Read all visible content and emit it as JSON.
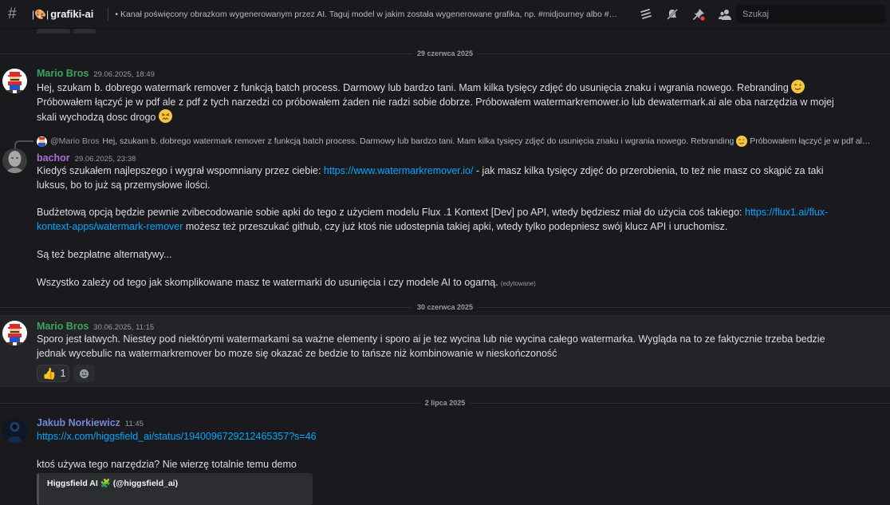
{
  "topbar": {
    "channel_prefix": "|🎨|",
    "channel_name": "grafiki-ai",
    "topic": "• Kanał poświęcony obrazkom wygenerowanym przez AI. Taguj model w jakim została wygenerowane grafika, np. #midjourney albo #…",
    "search_placeholder": "Szukaj"
  },
  "dividers": [
    "29 czerwca 2025",
    "30 czerwca 2025",
    "2 lipca 2025"
  ],
  "messages": {
    "m1": {
      "author": "Mario Bros",
      "author_color": "#3ba55c",
      "timestamp": "29.06.2025, 18:49",
      "line1": "Hej, szukam b. dobrego watermark remover z funkcją batch process. Darmowy lub bardzo tani. Mam kilka tysięcy zdjęć do usunięcia znaku i wgrania nowego. Rebranding",
      "line2": "Próbowałem łączyć je w pdf ale z pdf z tych narzedzi co próbowałem żaden nie radzi sobie dobrze. Próbowałem watermarkremower.io lub dewatermark.ai ale oba narzędzia w mojej skali wychodzą dosc drogo"
    },
    "m2": {
      "reply_mention": "@Mario Bros",
      "reply_text": "Hej, szukam b. dobrego watermark remover z funkcją batch process. Darmowy lub bardzo tani. Mam kilka tysięcy zdjęć do usunięcia znaku i wgrania nowego. Rebranding",
      "reply_text2": "Próbowałem łączyć je w pdf al…",
      "author": "bachor",
      "author_color": "#a970d6",
      "timestamp": "29.06.2025, 23:38",
      "p1_a": "Kiedyś szukałem najlepszego i wygrał wspomniany przez ciebie: ",
      "p1_link": "https://www.watermarkremover.io/",
      "p1_b": " - jak masz kilka tysięcy zdjęć do przerobienia, to też nie masz co skąpić za taki luksus, bo to już są przemysłowe ilości.",
      "p2_a": "Budżetową opcją będzie pewnie zvibecodowanie sobie apki do tego z użyciem modelu Flux .1 Kontext [Dev] po API, wtedy będziesz miał do użycia coś takiego: ",
      "p2_link": "https://flux1.ai/flux-kontext-apps/watermark-remover",
      "p2_b": " możesz też przeszukać github, czy już ktoś nie udostepnia takiej apki, wtedy tylko podepniesz swój klucz API i uruchomisz.",
      "p3": "Są też bezpłatne alternatywy...",
      "p4": "Wszystko zależy od tego jak skomplikowane masz te watermarki do usunięcia i czy modele AI to ogarną.",
      "edited": "(edytowane)"
    },
    "m3": {
      "author": "Mario Bros",
      "author_color": "#3ba55c",
      "timestamp": "30.06.2025, 11:15",
      "text": "Sporo jest łatwych. Niestey pod niektórymi watermarkami sa ważne elementy i sporo ai je tez wycina lub nie wycina całego watermarka. Wygląda na to ze faktycznie trzeba bedzie jednak wycebulic na watermarkremover bo moze się okazać ze bedzie to tańsze niż kombinowanie w nieskończoność",
      "reaction_emoji": "👍",
      "reaction_count": "1"
    },
    "m4": {
      "author": "Jakub Norkiewicz",
      "author_color": "#7289da",
      "timestamp": "11:45",
      "link": "https://x.com/higgsfield_ai/status/1940096729212465357?s=46",
      "text": "ktoś używa tego narzędzia? Nie wierzę totalnie temu demo",
      "embed_title": "Higgsfield AI 🧩 (@higgsfield_ai)"
    }
  }
}
